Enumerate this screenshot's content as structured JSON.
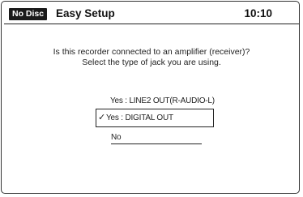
{
  "header": {
    "disc_status": "No Disc",
    "title": "Easy Setup",
    "clock": "10:10"
  },
  "prompt": {
    "line1": "Is this recorder connected to an amplifier (receiver)?",
    "line2": "Select the type of jack you are using."
  },
  "options": [
    {
      "label": "Yes : LINE2 OUT(R-AUDIO-L)",
      "selected": false
    },
    {
      "label": "Yes : DIGITAL OUT",
      "selected": true,
      "mark": "✓"
    },
    {
      "label": "No",
      "selected": false
    }
  ]
}
